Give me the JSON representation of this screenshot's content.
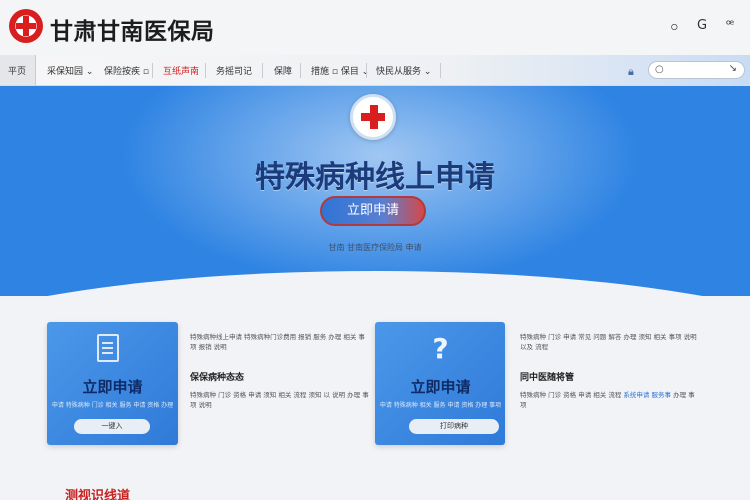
{
  "header": {
    "site_title": "甘肃甘南医保局",
    "icons": [
      "help-icon",
      "refresh-icon",
      "accessibility-icon"
    ],
    "icon_glyphs": [
      "ဝ",
      "G",
      "ꟹ"
    ]
  },
  "nav": {
    "items": [
      {
        "label": "平页",
        "active": false
      },
      {
        "label": "采保知园 ⌄",
        "active": false
      },
      {
        "label": "保险按疾 ▫",
        "active": false
      },
      {
        "label": "互纸声南",
        "active": true
      },
      {
        "label": "务摇司记",
        "active": false
      },
      {
        "label": "保障",
        "active": false
      },
      {
        "label": "措施 ▫ 保目 ⌄",
        "active": false
      },
      {
        "label": "快民从服务 ⌄",
        "active": false
      }
    ],
    "search_placeholder": ""
  },
  "hero": {
    "title": "特殊病种线上申请",
    "button_label": "立即申请",
    "note": "甘南 甘南医疗保险局 申请"
  },
  "cards": [
    {
      "icon": "document-icon",
      "title": "立即申请",
      "subtitle": "申请 特殊病种 门诊 相关 服务 申请 资格 办理",
      "button_label": "一键入",
      "info_desc": "特殊病种线上申请 特殊病种门诊费用 报销 服务 办理 相关 事项 报销 说明",
      "info_title": "保保病种态态",
      "info_body": "特殊病种 门诊 资格 申请 须知 相关 流程 须知 以 说明 办理 事项 说明"
    },
    {
      "icon": "question-icon",
      "title": "立即申请",
      "subtitle": "申请 特殊病种 相关 服务 申请 资格 办理 事项",
      "button_label": "打印病种",
      "info_desc": "特殊病种 门诊 申请 常见 问题 解答 办理 须知 相关 事项 说明 以及 流程",
      "info_title": "同中医随将管",
      "info_body": "特殊病种 门诊 资格 申请 相关 流程",
      "info_link": "系统申请 服务事",
      "info_tail": "办理 事项"
    }
  ],
  "bottom_heading": "测视识线道"
}
